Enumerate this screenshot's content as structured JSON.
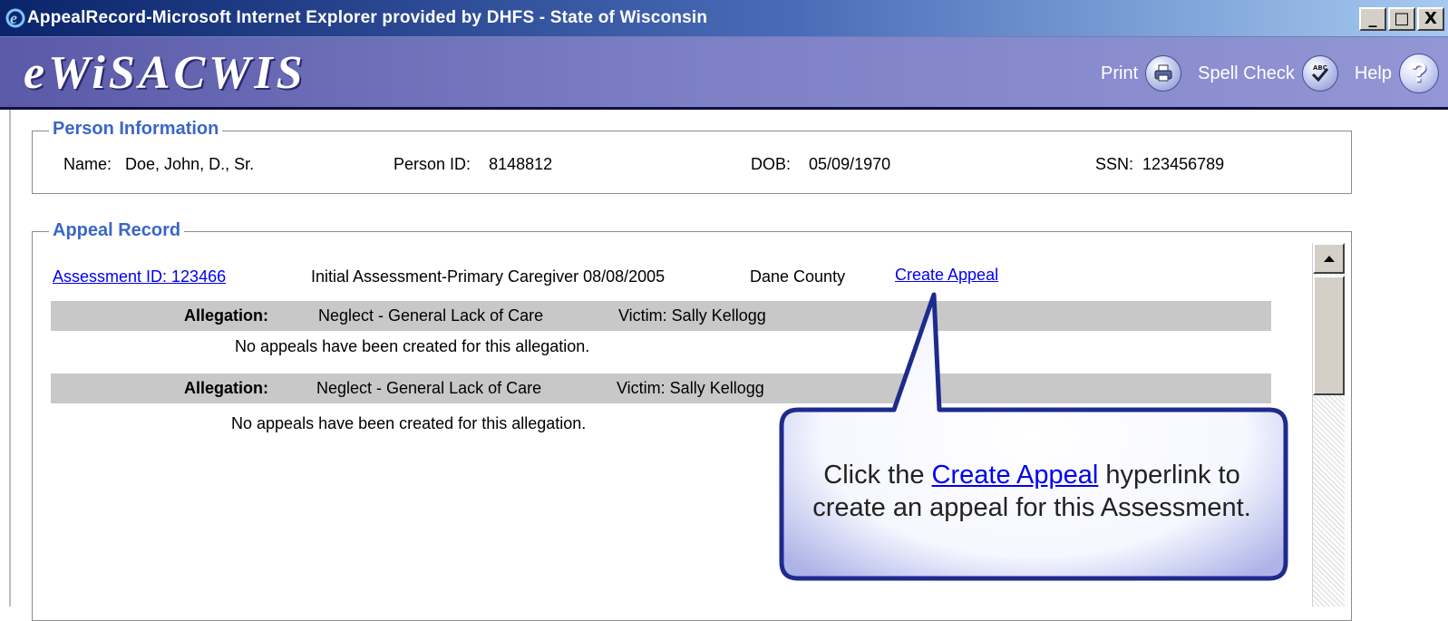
{
  "window": {
    "title": "AppealRecord-Microsoft Internet Explorer provided by DHFS - State of Wisconsin",
    "minimize": "_",
    "maximize": "□",
    "close": "X"
  },
  "header": {
    "logo": "eWiSACWIS",
    "print_label": "Print",
    "spellcheck_label": "Spell Check",
    "help_label": "Help",
    "help_glyph": "?"
  },
  "person_info": {
    "legend": "Person Information",
    "name_label": "Name:",
    "name_value": "Doe, John, D., Sr.",
    "person_id_label": "Person ID:",
    "person_id_value": "8148812",
    "dob_label": "DOB:",
    "dob_value": "05/09/1970",
    "ssn_label": "SSN:",
    "ssn_value": "123456789"
  },
  "appeal_record": {
    "legend": "Appeal Record",
    "assessment_link": "Assessment ID: 123466",
    "assessment_desc": "Initial Assessment-Primary Caregiver 08/08/2005",
    "county": "Dane County",
    "create_appeal_link": "Create Appeal",
    "allegations": [
      {
        "label": "Allegation:",
        "type": "Neglect - General Lack of Care",
        "victim": "Victim: Sally Kellogg",
        "message": "No appeals have been created for this allegation."
      },
      {
        "label": "Allegation:",
        "type": "Neglect - General Lack of Care",
        "victim": "Victim: Sally Kellogg",
        "message": "No appeals have been created for this allegation."
      }
    ]
  },
  "callout": {
    "before": "Click the ",
    "link": "Create Appeal",
    "after": " hyperlink to",
    "line2": "create an appeal for this Assessment."
  },
  "colors": {
    "title_bar": "#0a246a",
    "header": "#7b7ec4",
    "legend": "#3a66c8",
    "link": "#0000ee",
    "band": "#c8c8c8",
    "callout_border": "#2a2a88"
  }
}
